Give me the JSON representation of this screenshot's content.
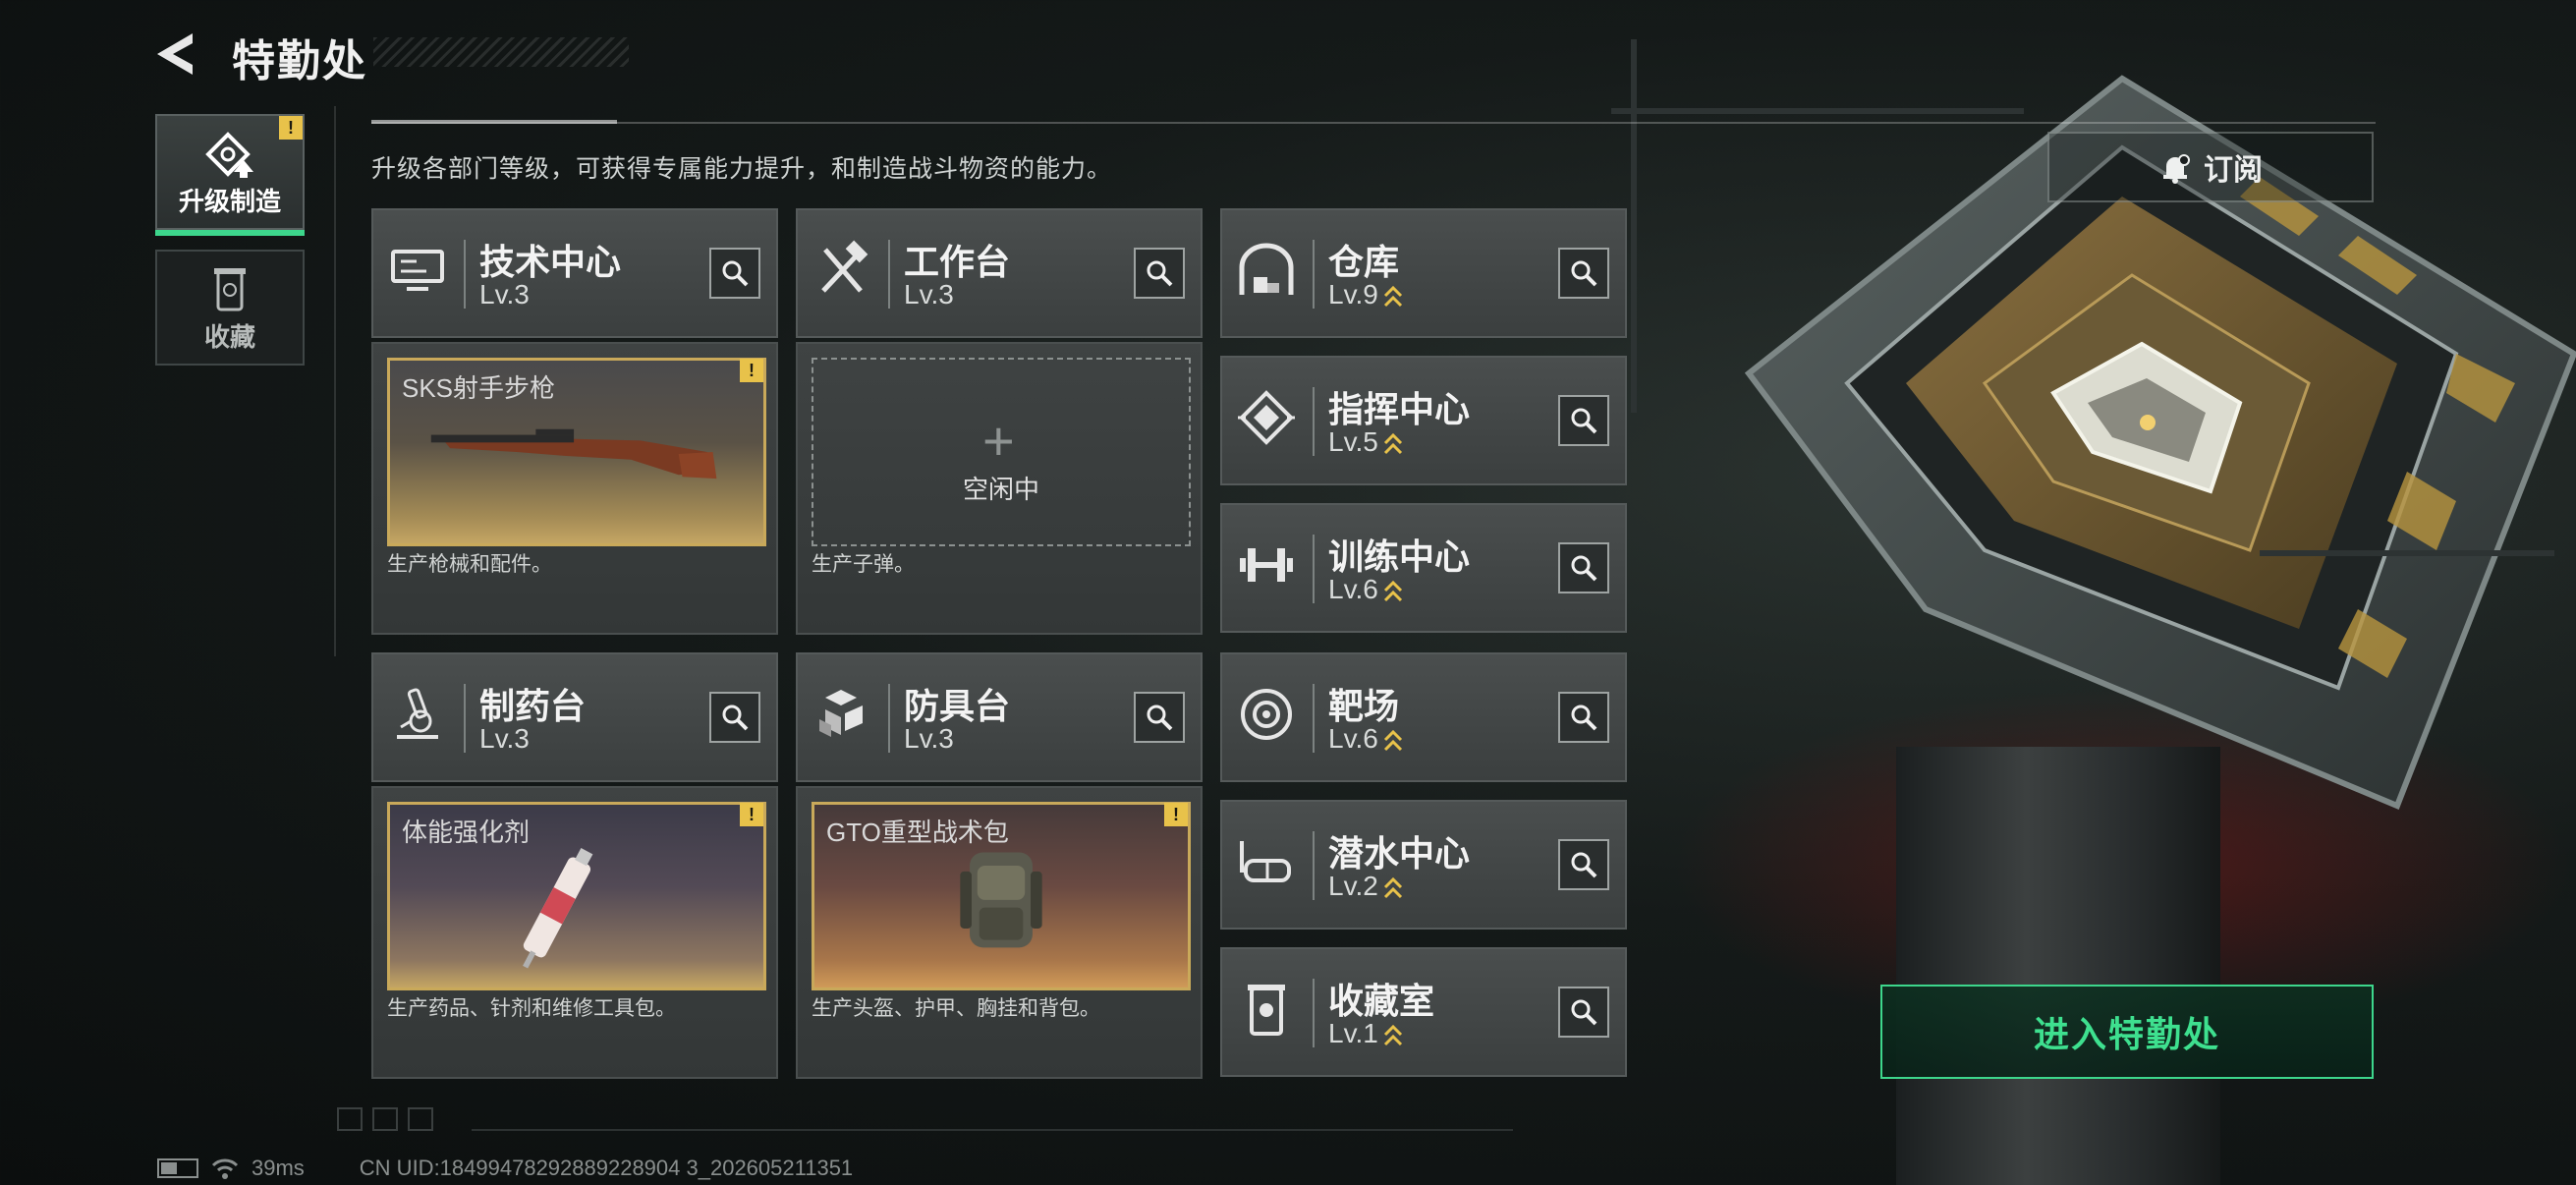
{
  "header": {
    "title": "特勤处",
    "description": "升级各部门等级，可获得专属能力提升，和制造战斗物资的能力。"
  },
  "side_tabs": [
    {
      "label": "升级制造",
      "icon": "upgrade-craft-icon",
      "active": true,
      "badge": "!"
    },
    {
      "label": "收藏",
      "icon": "collection-icon",
      "active": false
    }
  ],
  "departments": [
    {
      "name": "技术中心",
      "level": "Lv.3",
      "icon": "tech-center-icon",
      "upgradable": false
    },
    {
      "name": "工作台",
      "level": "Lv.3",
      "icon": "workbench-icon",
      "upgradable": false
    },
    {
      "name": "仓库",
      "level": "Lv.9",
      "icon": "warehouse-icon",
      "upgradable": true
    },
    {
      "name": "指挥中心",
      "level": "Lv.5",
      "icon": "command-center-icon",
      "upgradable": true
    },
    {
      "name": "训练中心",
      "level": "Lv.6",
      "icon": "training-center-icon",
      "upgradable": true
    },
    {
      "name": "制药台",
      "level": "Lv.3",
      "icon": "pharmacy-icon",
      "upgradable": false
    },
    {
      "name": "防具台",
      "level": "Lv.3",
      "icon": "armor-bench-icon",
      "upgradable": false
    },
    {
      "name": "靶场",
      "level": "Lv.6",
      "icon": "shooting-range-icon",
      "upgradable": true
    },
    {
      "name": "潜水中心",
      "level": "Lv.2",
      "icon": "diving-center-icon",
      "upgradable": true
    },
    {
      "name": "收藏室",
      "level": "Lv.1",
      "icon": "collection-room-icon",
      "upgradable": true
    }
  ],
  "production": [
    {
      "item": "SKS射手步枪",
      "description": "生产枪械和配件。",
      "badge": "!"
    },
    {
      "empty_label": "空闲中",
      "plus": "+",
      "description": "生产子弹。"
    },
    {
      "item": "体能强化剂",
      "description": "生产药品、针剂和维修工具包。",
      "badge": "!"
    },
    {
      "item": "GTO重型战术包",
      "description": "生产头盔、护甲、胸挂和背包。",
      "badge": "!"
    }
  ],
  "actions": {
    "subscribe_label": "订阅",
    "enter_label": "进入特勤处"
  },
  "footer": {
    "ping": "39ms",
    "uid": "CN UID:18499478292889228904 3_202605211351"
  },
  "colors": {
    "accent_green": "#3dd68c",
    "gold": "#c9a95a",
    "badge_yellow": "#e8c24a"
  }
}
